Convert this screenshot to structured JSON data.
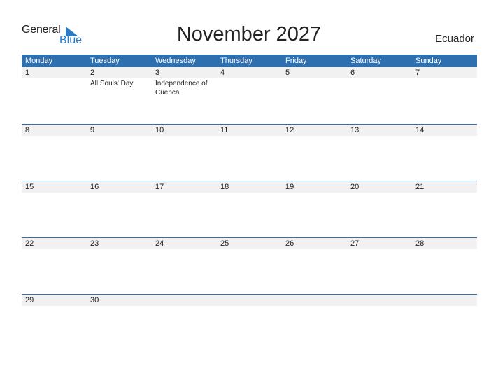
{
  "logo": {
    "word1": "General",
    "word2": "Blue"
  },
  "header": {
    "title": "November 2027",
    "country": "Ecuador"
  },
  "weekdays": [
    "Monday",
    "Tuesday",
    "Wednesday",
    "Thursday",
    "Friday",
    "Saturday",
    "Sunday"
  ],
  "weeks": [
    [
      {
        "d": "1",
        "e": ""
      },
      {
        "d": "2",
        "e": "All Souls' Day"
      },
      {
        "d": "3",
        "e": "Independence of Cuenca"
      },
      {
        "d": "4",
        "e": ""
      },
      {
        "d": "5",
        "e": ""
      },
      {
        "d": "6",
        "e": ""
      },
      {
        "d": "7",
        "e": ""
      }
    ],
    [
      {
        "d": "8",
        "e": ""
      },
      {
        "d": "9",
        "e": ""
      },
      {
        "d": "10",
        "e": ""
      },
      {
        "d": "11",
        "e": ""
      },
      {
        "d": "12",
        "e": ""
      },
      {
        "d": "13",
        "e": ""
      },
      {
        "d": "14",
        "e": ""
      }
    ],
    [
      {
        "d": "15",
        "e": ""
      },
      {
        "d": "16",
        "e": ""
      },
      {
        "d": "17",
        "e": ""
      },
      {
        "d": "18",
        "e": ""
      },
      {
        "d": "19",
        "e": ""
      },
      {
        "d": "20",
        "e": ""
      },
      {
        "d": "21",
        "e": ""
      }
    ],
    [
      {
        "d": "22",
        "e": ""
      },
      {
        "d": "23",
        "e": ""
      },
      {
        "d": "24",
        "e": ""
      },
      {
        "d": "25",
        "e": ""
      },
      {
        "d": "26",
        "e": ""
      },
      {
        "d": "27",
        "e": ""
      },
      {
        "d": "28",
        "e": ""
      }
    ],
    [
      {
        "d": "29",
        "e": ""
      },
      {
        "d": "30",
        "e": ""
      },
      {
        "d": "",
        "e": ""
      },
      {
        "d": "",
        "e": ""
      },
      {
        "d": "",
        "e": ""
      },
      {
        "d": "",
        "e": ""
      },
      {
        "d": "",
        "e": ""
      }
    ]
  ],
  "colors": {
    "accent": "#2e6fb0",
    "logo_blue": "#2a7bc4",
    "date_strip": "#f1f1f1"
  }
}
